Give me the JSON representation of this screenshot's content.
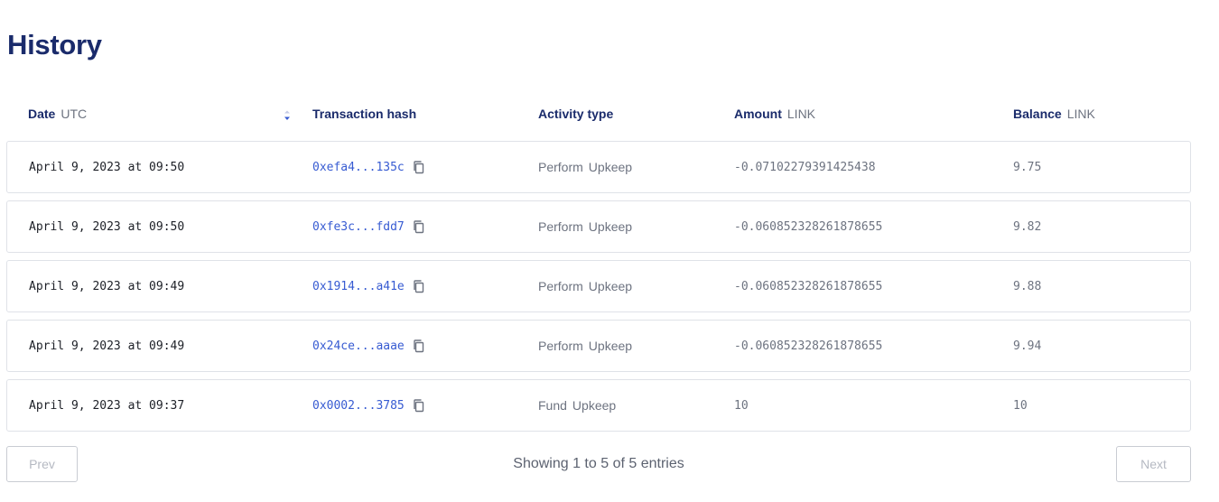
{
  "title": "History",
  "columns": {
    "date": {
      "label": "Date",
      "unit": "UTC"
    },
    "hash": {
      "label": "Transaction hash"
    },
    "type": {
      "label": "Activity type"
    },
    "amount": {
      "label": "Amount",
      "unit": "LINK"
    },
    "balance": {
      "label": "Balance",
      "unit": "LINK"
    }
  },
  "rows": [
    {
      "date": "April 9, 2023 at 09:50",
      "hash": "0xefa4...135c",
      "type_a": "Perform",
      "type_b": "Upkeep",
      "amount": "-0.07102279391425438",
      "balance": "9.75"
    },
    {
      "date": "April 9, 2023 at 09:50",
      "hash": "0xfe3c...fdd7",
      "type_a": "Perform",
      "type_b": "Upkeep",
      "amount": "-0.060852328261878655",
      "balance": "9.82"
    },
    {
      "date": "April 9, 2023 at 09:49",
      "hash": "0x1914...a41e",
      "type_a": "Perform",
      "type_b": "Upkeep",
      "amount": "-0.060852328261878655",
      "balance": "9.88"
    },
    {
      "date": "April 9, 2023 at 09:49",
      "hash": "0x24ce...aaae",
      "type_a": "Perform",
      "type_b": "Upkeep",
      "amount": "-0.060852328261878655",
      "balance": "9.94"
    },
    {
      "date": "April 9, 2023 at 09:37",
      "hash": "0x0002...3785",
      "type_a": "Fund",
      "type_b": "Upkeep",
      "amount": "10",
      "balance": "10"
    }
  ],
  "pagination": {
    "prev_label": "Prev",
    "next_label": "Next",
    "showing_text": "Showing 1 to 5 of 5 entries"
  },
  "icons": {
    "sort": "sort-desc-icon",
    "copy": "copy-icon"
  },
  "colors": {
    "heading": "#1a2b6b",
    "link": "#375bd2",
    "muted": "#6d7380",
    "border": "#dfe2e8"
  }
}
